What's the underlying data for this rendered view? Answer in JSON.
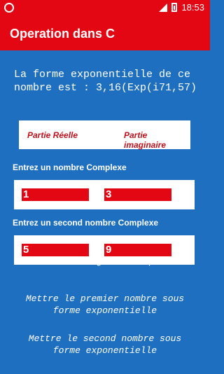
{
  "status": {
    "time": "18:53"
  },
  "app": {
    "title": "Operation dans C"
  },
  "result": {
    "text": "La forme exponentielle de ce nombre est : 3,16(Exp(i71,57)"
  },
  "tabs": {
    "real": "Partie Réelle",
    "imag": "Partie imaginaire"
  },
  "first": {
    "label": "Entrez un nombre Complexe",
    "real": "1",
    "imag": "3"
  },
  "second": {
    "label": "Entrez un second nombre Complexe",
    "real": "5",
    "imag": "9"
  },
  "actions": {
    "partial": "forme trigonometrique",
    "first_exp": "Mettre le premier nombre sous forme exponentielle",
    "second_exp": "Mettre le second nombre sous forme exponentielle"
  },
  "colors": {
    "accent": "#e30613",
    "background": "#1e6fbf"
  }
}
